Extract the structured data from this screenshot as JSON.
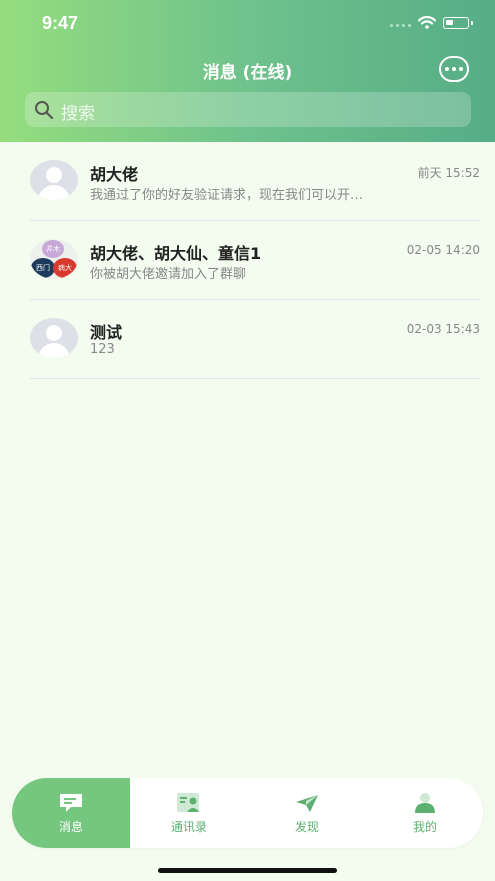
{
  "status": {
    "time": "9:47"
  },
  "header": {
    "title": "消息 (在线)"
  },
  "search": {
    "placeholder": "搜索"
  },
  "conversations": [
    {
      "name": "胡大佬",
      "preview": "我通过了你的好友验证请求，现在我们可以开…",
      "time": "前天 15:52"
    },
    {
      "name": "胡大佬、胡大仙、童信1",
      "preview": "你被胡大佬邀请加入了群聊",
      "time": "02-05 14:20",
      "group_initials": [
        "井木",
        "西门",
        "病大"
      ]
    },
    {
      "name": "测试",
      "preview": "123",
      "time": "02-03 15:43"
    }
  ],
  "tabs": [
    {
      "label": "消息",
      "icon": "message-icon"
    },
    {
      "label": "通讯录",
      "icon": "contacts-icon"
    },
    {
      "label": "发现",
      "icon": "discover-icon"
    },
    {
      "label": "我的",
      "icon": "profile-icon"
    }
  ],
  "colors": {
    "accent": "#75c67f",
    "header_start": "#95dd7e",
    "header_end": "#56ad86"
  }
}
